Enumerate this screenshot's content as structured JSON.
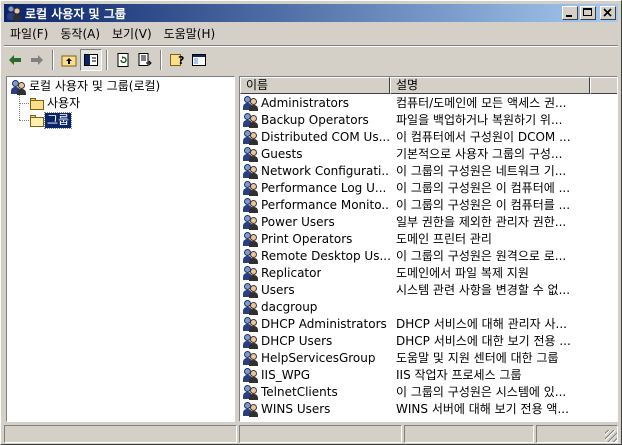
{
  "window": {
    "title": "로컬 사용자 및 그룹"
  },
  "menu": [
    {
      "label": "파일(F)"
    },
    {
      "label": "동작(A)"
    },
    {
      "label": "보기(V)"
    },
    {
      "label": "도움말(H)"
    }
  ],
  "toolbar": {
    "icons": [
      "back-arrow-icon",
      "forward-arrow-icon",
      "up-folder-icon",
      "show-hide-tree-icon",
      "refresh-icon",
      "export-list-icon",
      "help-icon",
      "console-icon"
    ]
  },
  "tree": {
    "root": "로컬 사용자 및 그룹(로컬)",
    "children": [
      {
        "label": "사용자"
      },
      {
        "label": "그룹"
      }
    ]
  },
  "list": {
    "columns": [
      "이름",
      "설명"
    ],
    "rows": [
      {
        "name": "Administrators",
        "desc": "컴퓨터/도메인에 모든 액세스 권..."
      },
      {
        "name": "Backup Operators",
        "desc": "파일을 백업하거나 복원하기 위..."
      },
      {
        "name": "Distributed COM Us...",
        "desc": "이 컴퓨터에서 구성원이 DCOM ..."
      },
      {
        "name": "Guests",
        "desc": "기본적으로 사용자 그룹의 구성..."
      },
      {
        "name": "Network Configurati...",
        "desc": "이 그룹의 구성원은 네트워크 기..."
      },
      {
        "name": "Performance Log U...",
        "desc": "이 그룹의 구성원은 이 컴퓨터에 ..."
      },
      {
        "name": "Performance Monito...",
        "desc": "이 그룹의 구성원은 이 컴퓨터를 ..."
      },
      {
        "name": "Power Users",
        "desc": "일부 권한을 제외한 관리자 권한..."
      },
      {
        "name": "Print Operators",
        "desc": "도메인 프린터 관리"
      },
      {
        "name": "Remote Desktop Us...",
        "desc": "이 그룹의 구성원은 원격으로 로..."
      },
      {
        "name": "Replicator",
        "desc": "도메인에서 파일 복제 지원"
      },
      {
        "name": "Users",
        "desc": "시스템 관련 사항을 변경할 수 없..."
      },
      {
        "name": "dacgroup",
        "desc": ""
      },
      {
        "name": "DHCP Administrators",
        "desc": "DHCP 서비스에 대해 관리자 사..."
      },
      {
        "name": "DHCP Users",
        "desc": "DHCP 서비스에 대한 보기 전용 ..."
      },
      {
        "name": "HelpServicesGroup",
        "desc": "도움말 및 지원 센터에 대한 그룹"
      },
      {
        "name": "IIS_WPG",
        "desc": "IIS 작업자 프로세스 그룹"
      },
      {
        "name": "TelnetClients",
        "desc": "이 그룹의 구성원은 시스템에 있..."
      },
      {
        "name": "WINS Users",
        "desc": "WINS 서버에 대해 보기 전용 액..."
      }
    ]
  },
  "colors": {
    "title_start": "#0a246a",
    "title_end": "#a6caf0",
    "face": "#d4d0c8",
    "selection": "#0a246a"
  }
}
